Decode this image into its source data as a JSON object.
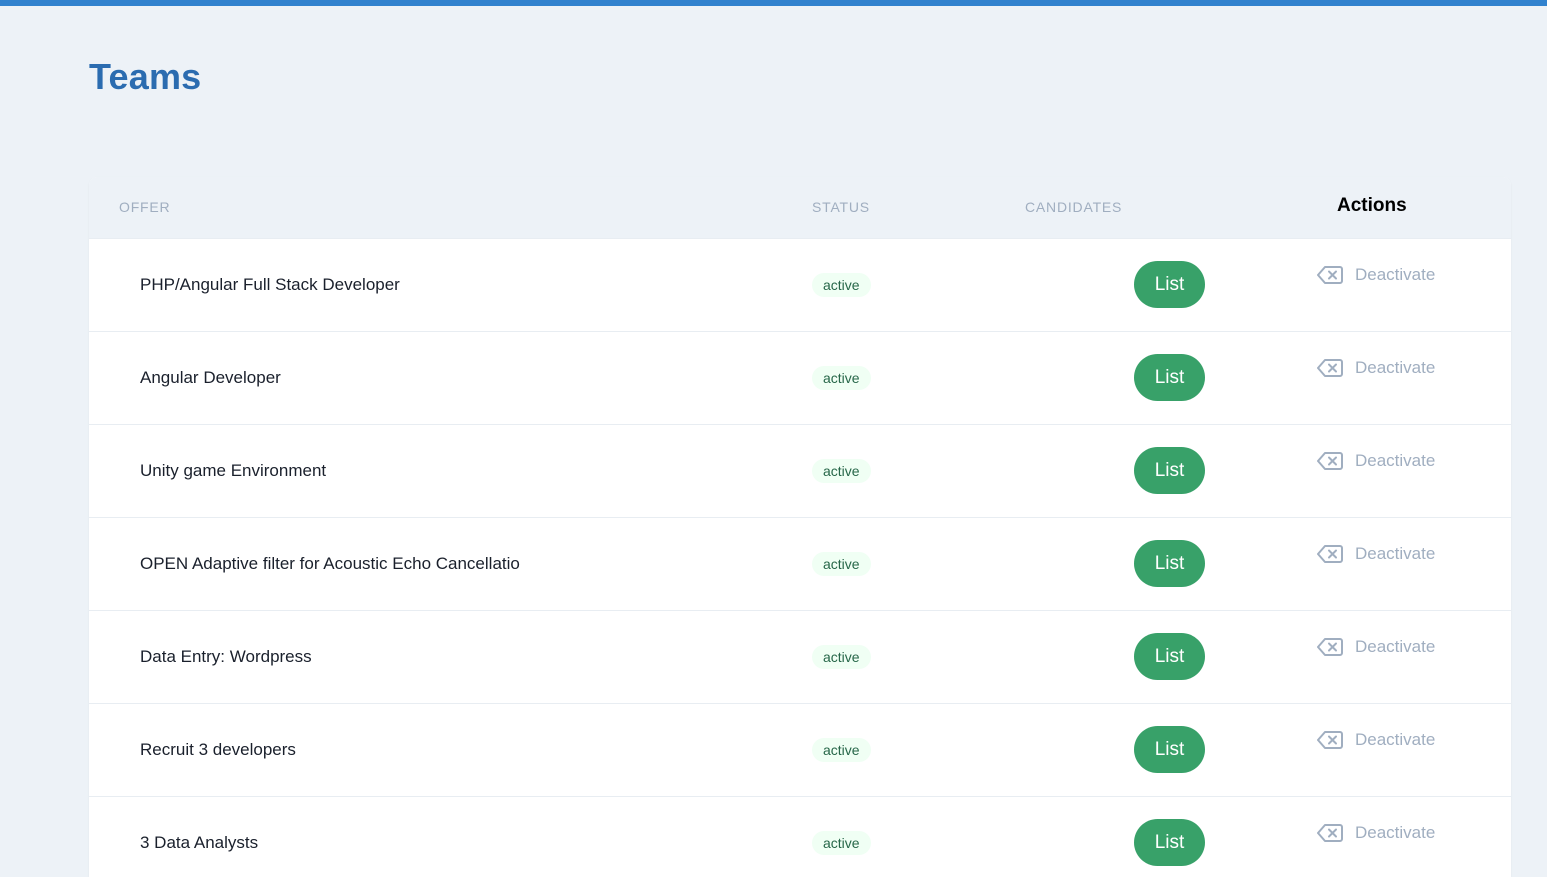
{
  "page": {
    "title": "Teams"
  },
  "table": {
    "headers": {
      "offer": "OFFER",
      "status": "STATUS",
      "candidates": "CANDIDATES",
      "actions": "Actions"
    },
    "rows": [
      {
        "title": "PHP/Angular Full Stack Developer",
        "status": "active",
        "list_label": "List",
        "action_label": "Deactivate"
      },
      {
        "title": "Angular Developer",
        "status": "active",
        "list_label": "List",
        "action_label": "Deactivate"
      },
      {
        "title": "Unity game Environment",
        "status": "active",
        "list_label": "List",
        "action_label": "Deactivate"
      },
      {
        "title": "OPEN Adaptive filter for Acoustic Echo Cancellatio",
        "status": "active",
        "list_label": "List",
        "action_label": "Deactivate"
      },
      {
        "title": "Data Entry: Wordpress",
        "status": "active",
        "list_label": "List",
        "action_label": "Deactivate"
      },
      {
        "title": "Recruit 3 developers",
        "status": "active",
        "list_label": "List",
        "action_label": "Deactivate"
      },
      {
        "title": "3 Data Analysts",
        "status": "active",
        "list_label": "List",
        "action_label": "Deactivate"
      }
    ]
  },
  "icons": {
    "deactivate": "backspace-x-icon"
  },
  "colors": {
    "accent": "#3182ce",
    "title": "#2b6cb0",
    "list_button": "#38a169",
    "status_badge_bg": "#f0fff4",
    "status_badge_text": "#276749",
    "muted": "#a0aec0"
  }
}
